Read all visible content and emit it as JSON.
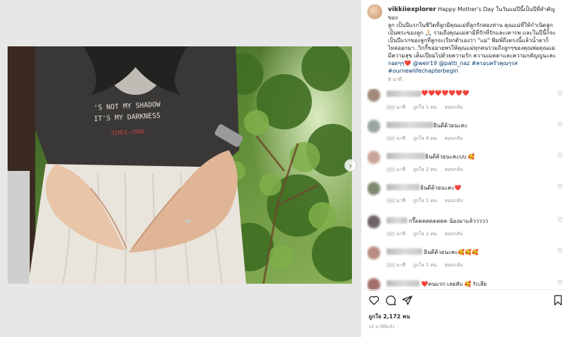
{
  "post": {
    "username": "vikkiiexplorer",
    "caption_lines": [
      "Happy Mother's Day ในวันแม่ปีนี้เป็นปีที่สำคัญของ",
      "ลูก เป็นปีแรกในชีวิตที่ลูกมีคุณแม่ที่ลูกรักสองท่าน คุณแม่ที่ให้กำเนิดลูก",
      "เป็นพระของลูก 🙏🏻 รวมถึงคุณแม่สามีที่รักที่รักและเคารพ และในปีนี้ก็จะ",
      "เป็นปีแรกของลูกที่ลูกจะเรียกตัวเองว่า \"แม่\" พิมพ์ถึงตรงนี้แล้วน้ำตาก็",
      "ไหลออกมา..วิกกี้ขออวยพรให้คุณแม่ทุกคนรวมถึงลูกๆของคุณพ่อคุณแม่",
      "มีความสุข เต็มเปี่ยมไปด้วยความรัก ความเมตตาและความกตัญญูนะคะ",
      "กอดๆๆ❤️ @weir19 @patti_naz #ครอบครัวคุณๆรส",
      "#ournewlifechapterbegin"
    ],
    "time": "8 นาที"
  },
  "photo": {
    "shirt_text_1": "'S NOT MY SHADOW",
    "shirt_text_2": "IT'S MY DARKNESS",
    "shirt_text_3": "SINCE—1980"
  },
  "comments": [
    {
      "text": "❤️❤️❤️❤️❤️❤️❤️",
      "meta": [
        "นาที",
        "ถูกใจ 1 คน",
        "ตอบกลับ"
      ],
      "avatar_color": "#a1887a",
      "name_w": 50,
      "text_x": 78
    },
    {
      "text": "ยินดีด้วยนะคะ",
      "meta": [
        "นาที",
        "ถูกใจ 4 คน",
        "ตอบกลับ"
      ],
      "avatar_color": "#9aa6a0",
      "name_w": 68,
      "text_x": 96
    },
    {
      "text": "ยินดีด้วยนะคะบบ 🥰",
      "meta": [
        "นาที",
        "ถูกใจ 2 คน",
        "ตอบกลับ"
      ],
      "avatar_color": "#c9a69b",
      "name_w": 56,
      "text_x": 84
    },
    {
      "text": "ยินดีด้วยนะคะ❤️",
      "meta": [
        "นาที",
        "ถูกใจ 1 คน",
        "ตอบกลับ"
      ],
      "avatar_color": "#7f8a72",
      "name_w": 48,
      "text_x": 77
    },
    {
      "text": "กรี๊ดดดดดดดดด น้องมาแล้ววววว",
      "meta": [
        "นาที",
        "ถูกใจ 1 คน",
        "ตอบกลับ"
      ],
      "avatar_color": "#6d6368",
      "name_w": 30,
      "text_x": 60
    },
    {
      "text": "ยินดีด้วยนะคะ🥰🥰🥰",
      "meta": [
        "นาที",
        "ถูกใจ 1 คน",
        "ตอบกลับ"
      ],
      "avatar_color": "#b88c80",
      "name_w": 52,
      "text_x": 82
    },
    {
      "text": "❤️คนแรก เลยคับ 🥰 fcเสีย",
      "meta": [],
      "avatar_color": "#a3706a",
      "name_w": 48,
      "text_x": 78
    }
  ],
  "footer": {
    "likes": "ถูกใจ 2,172 คน",
    "ago": "10 นาทีที่แล้ว"
  },
  "icons": {
    "like": "heart-icon",
    "comment": "comment-icon",
    "share": "share-icon",
    "save": "bookmark-icon",
    "carousel": "chevron-right-icon"
  }
}
